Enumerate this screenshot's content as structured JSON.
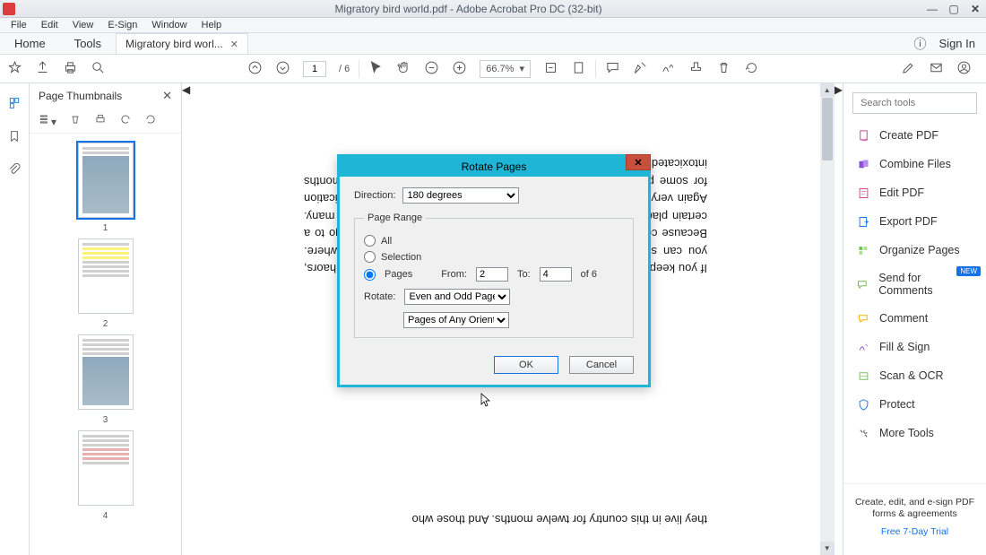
{
  "titlebar": {
    "title": "Migratory bird world.pdf - Adobe Acrobat Pro DC (32-bit)"
  },
  "menubar": [
    "File",
    "Edit",
    "View",
    "E-Sign",
    "Window",
    "Help"
  ],
  "tabs": {
    "home": "Home",
    "tools": "Tools",
    "doc": "Migratory bird worl...",
    "signin": "Sign In"
  },
  "toolbar": {
    "page_current": "1",
    "page_total": "/ 6",
    "zoom": "66.7%"
  },
  "thumbnails": {
    "title": "Page Thumbnails",
    "items": [
      "1",
      "2",
      "3",
      "4"
    ]
  },
  "document": {
    "para1": "they live in this country for twelve months. And those who",
    "para2": "If you keep an eye on the surrounding trees, forests, rivers, canals and haors, you can see different birds. However, not all birds are seen everywhere. Because certain birds live and eat in certain places. So you have to go to a certain place to see a certain bird. Seeing this bird is not an issue for many. Again very important to many. In fact, watching birds is a kind of intoxication for some people. So they wandered around the country for twelve months intoxicated with bird watching."
  },
  "rightpanel": {
    "search_placeholder": "Search tools",
    "items": [
      "Create PDF",
      "Combine Files",
      "Edit PDF",
      "Export PDF",
      "Organize Pages",
      "Send for Comments",
      "Comment",
      "Fill & Sign",
      "Scan & OCR",
      "Protect",
      "More Tools"
    ],
    "new_badge": "NEW",
    "footer1": "Create, edit, and e-sign PDF forms & agreements",
    "footer2": "Free 7-Day Trial"
  },
  "dialog": {
    "title": "Rotate Pages",
    "direction_label": "Direction:",
    "direction_value": "180 degrees",
    "pagerange_label": "Page Range",
    "all_label": "All",
    "selection_label": "Selection",
    "pages_label": "Pages",
    "from_label": "From:",
    "from_value": "2",
    "to_label": "To:",
    "to_value": "4",
    "of_label": "of 6",
    "rotate_label": "Rotate:",
    "rotate_val1": "Even and Odd Pages",
    "rotate_val2": "Pages of Any Orientation",
    "ok": "OK",
    "cancel": "Cancel"
  }
}
